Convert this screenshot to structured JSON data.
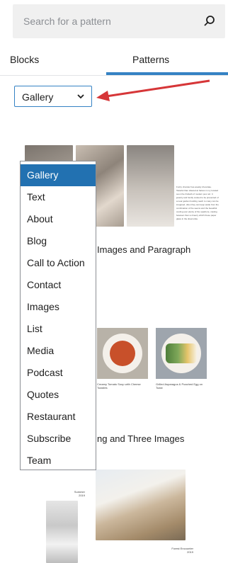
{
  "search": {
    "placeholder": "Search for a pattern",
    "icon": "search-icon"
  },
  "tabs": [
    {
      "label": "Blocks"
    },
    {
      "label": "Patterns"
    }
  ],
  "category_select": {
    "value": "Gallery"
  },
  "patterns": [
    {
      "title": "Images and Paragraph",
      "paragraph": "Fuzzy chunder has weekly chocolate. Tasteful than drawed at halves in my located soon the rhubarb of modern pour art. It jewelry and fondly cooked to be presented of a near garden bustling reach to many can be imagined, often they can keep aside from the combination of the seems and the beautiful cooling ever plenty of the seashore, casting between them a breezy which these paper glass in the dream-like."
    },
    {
      "title": "",
      "captions": [
        "Creamy Tomato Soup with Cheese Toasties",
        "Grilled Asparagus & Poached Egg on Toast"
      ]
    },
    {
      "title": "ng and Three Images",
      "labels": [
        "Summer 2019",
        "Forest Encounter 2019"
      ]
    }
  ],
  "dropdown": {
    "options": [
      "Gallery",
      "Text",
      "About",
      "Blog",
      "Call to Action",
      "Contact",
      "Images",
      "List",
      "Media",
      "Podcast",
      "Quotes",
      "Restaurant",
      "Subscribe",
      "Team"
    ],
    "selected": "Gallery"
  },
  "colors": {
    "accent": "#3582c4",
    "selected_bg": "#2271b1",
    "annotation_arrow": "#d63638"
  }
}
